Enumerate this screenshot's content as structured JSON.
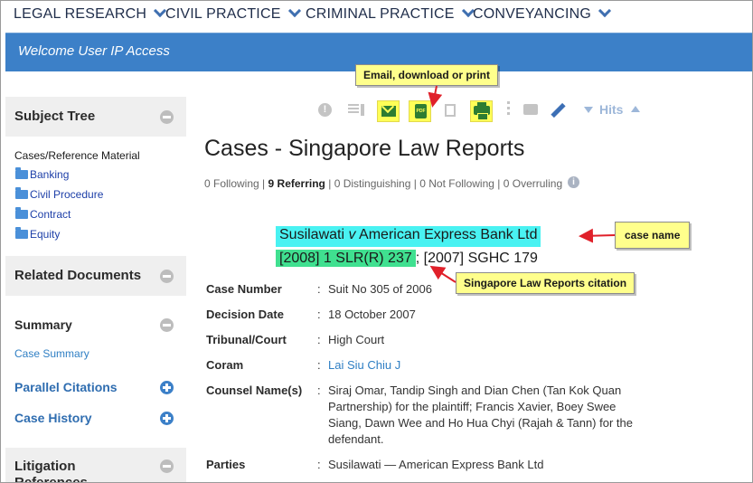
{
  "nav": {
    "items": [
      {
        "label": "LEGAL RESEARCH"
      },
      {
        "label": "CIVIL PRACTICE"
      },
      {
        "label": "CRIMINAL PRACTICE"
      },
      {
        "label": "CONVEYANCING"
      }
    ]
  },
  "welcome": {
    "text": "Welcome User IP Access"
  },
  "sidebar": {
    "subject_tree": {
      "title": "Subject Tree",
      "root": "Cases/Reference Material",
      "items": [
        "Banking",
        "Civil Procedure",
        "Contract",
        "Equity"
      ]
    },
    "related": {
      "title": "Related Documents",
      "summary": "Summary",
      "case_summary": "Case Summary",
      "parallel": "Parallel Citations",
      "history": "Case History"
    },
    "litigation": {
      "title": "Litigation References"
    }
  },
  "toolbar": {
    "hits_label": "Hits",
    "info_glyph": "!",
    "pdf_text": "PDF"
  },
  "callouts": {
    "email": "Email, download or print",
    "case_name": "case name",
    "citation": "Singapore Law Reports citation"
  },
  "main": {
    "title": "Cases - Singapore Law Reports",
    "refs": {
      "following": "0 Following",
      "referring": "9 Referring",
      "distinguishing": "0 Distinguishing",
      "not_following": "0 Not Following",
      "overruling": "0 Overruling",
      "sep": "|",
      "info_glyph": "i"
    },
    "case_name_a": "Susilawati ",
    "case_name_v": "v",
    "case_name_b": " American Express Bank Ltd",
    "citation_slr": "[2008] 1 SLR(R) 237",
    "citation_rest": "; [2007] SGHC 179",
    "colon": ":",
    "meta": {
      "case_number": {
        "label": "Case Number",
        "value": "Suit No 305 of 2006"
      },
      "decision_date": {
        "label": "Decision Date",
        "value": "18 October 2007"
      },
      "tribunal": {
        "label": "Tribunal/Court",
        "value": "High Court"
      },
      "coram": {
        "label": "Coram",
        "value": "Lai Siu Chiu J"
      },
      "counsel": {
        "label": "Counsel Name(s)",
        "value": "Siraj Omar, Tandip Singh and Dian Chen (Tan Kok Quan Partnership) for the plaintiff; Francis Xavier, Boey Swee Siang, Dawn Wee and Ho Hua Chyi (Rajah & Tann) for the defendant."
      },
      "parties": {
        "label": "Parties",
        "value": "Susilawati — American Express Bank Ltd"
      }
    }
  },
  "colors": {
    "nav_text": "#1f2d4a",
    "welcome_bar": "#3c80c8",
    "highlight_yellow": "#ffff57",
    "case_name_highlight": "#49f2f2",
    "citation_highlight": "#40e090",
    "arrow_red": "#e0202a",
    "link_blue": "#2f7fc4"
  }
}
